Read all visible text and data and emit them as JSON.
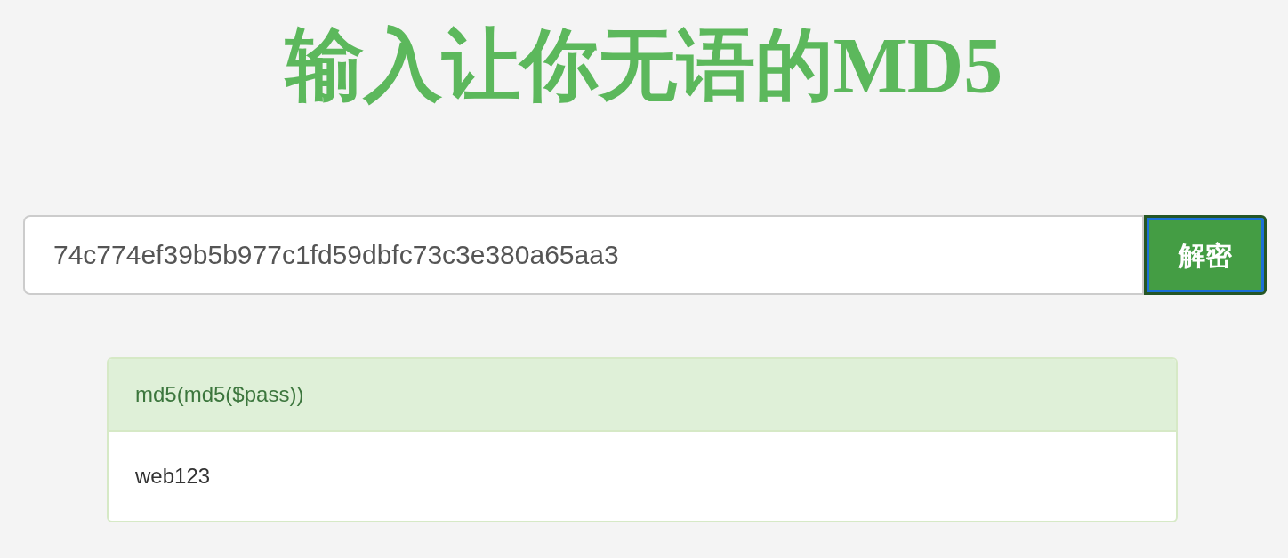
{
  "title": "输入让你无语的MD5",
  "search": {
    "value": "74c774ef39b5b977c1fd59dbfc73c3e380a65aa3",
    "button": "解密"
  },
  "result": {
    "heading": "md5(md5($pass))",
    "body": "web123"
  }
}
